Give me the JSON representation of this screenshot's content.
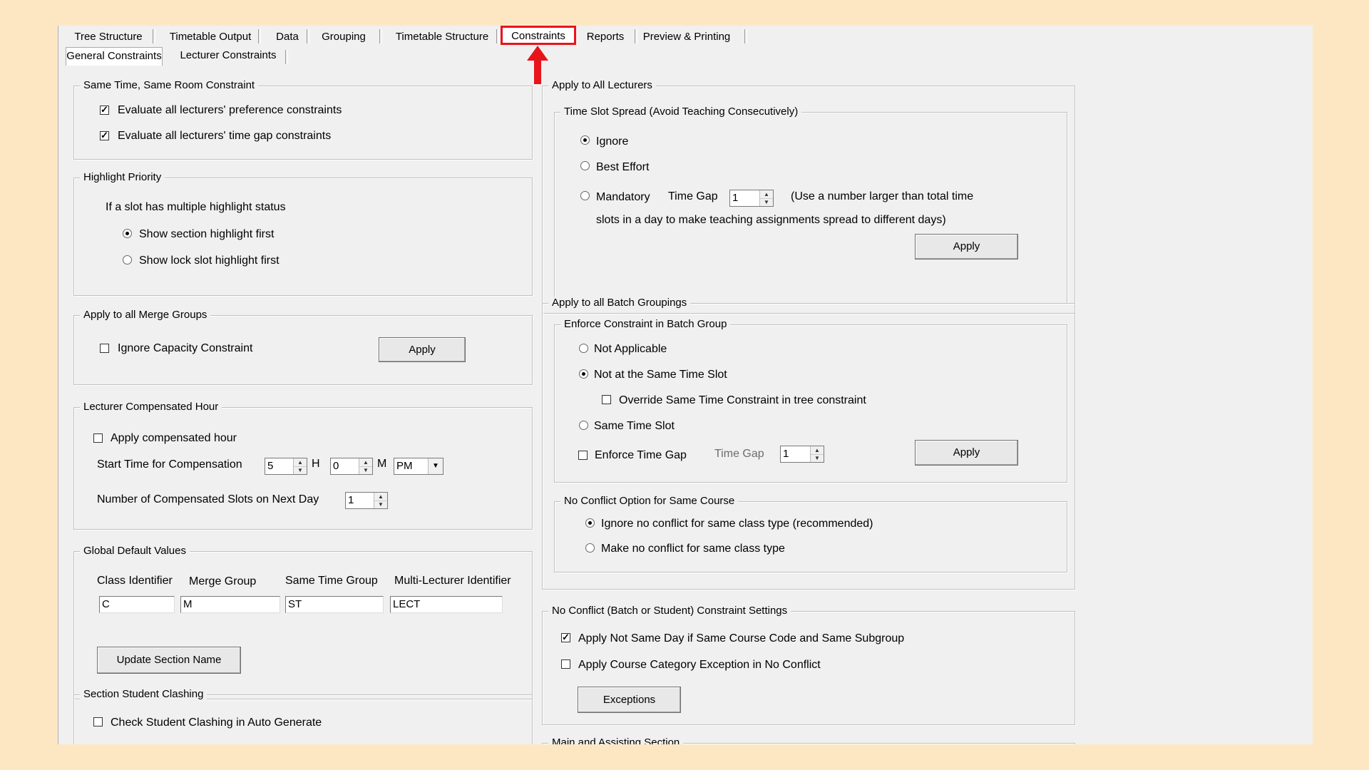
{
  "tabs": [
    "Tree Structure",
    "Timetable Output",
    "Data",
    "Grouping",
    "Timetable Structure",
    "Constraints",
    "Reports",
    "Preview & Printing"
  ],
  "sub_tabs": [
    "General Constraints",
    "Lecturer Constraints"
  ],
  "highlight_color": "#e8141c",
  "same_time_room": {
    "title": "Same Time, Same Room Constraint",
    "eval_pref": "Evaluate all lecturers' preference constraints",
    "eval_gap": "Evaluate all lecturers' time gap constraints"
  },
  "highlight_priority": {
    "title": "Highlight Priority",
    "desc": "If a slot has multiple highlight status",
    "opt_section": "Show section highlight first",
    "opt_lock": "Show lock slot highlight first"
  },
  "merge_groups": {
    "title": "Apply to all Merge Groups",
    "ignore_capacity": "Ignore Capacity Constraint",
    "apply": "Apply"
  },
  "compensated": {
    "title": "Lecturer Compensated Hour",
    "apply_hour": "Apply compensated hour",
    "start_label": "Start Time for Compensation",
    "hour_value": "5",
    "h": "H",
    "minute_value": "0",
    "m": "M",
    "ampm": "PM",
    "slots_label": "Number of Compensated Slots on Next Day",
    "slots_value": "1"
  },
  "global_defaults": {
    "title": "Global Default Values",
    "class_label": "Class Identifier",
    "merge_label": "Merge Group",
    "same_label": "Same Time Group",
    "multi_label": "Multi-Lecturer Identifier",
    "class_value": "C",
    "merge_value": "M",
    "same_value": "ST",
    "multi_value": "LECT",
    "update_btn": "Update Section Name"
  },
  "section_clash": {
    "title": "Section Student Clashing",
    "check": "Check Student Clashing in Auto Generate"
  },
  "all_lecturers": {
    "title": "Apply to All Lecturers",
    "spread_title": "Time Slot Spread (Avoid Teaching Consecutively)",
    "ignore": "Ignore",
    "best": "Best Effort",
    "mandatory": "Mandatory",
    "time_gap_label": "Time Gap",
    "time_gap_value": "1",
    "note1": "(Use a number larger than total time",
    "note2": "slots in a day to make teaching assignments spread to different days)",
    "apply": "Apply"
  },
  "batch": {
    "title": "Apply to all Batch Groupings",
    "enforce_title": "Enforce Constraint in Batch Group",
    "not_applicable": "Not Applicable",
    "not_same": "Not at the Same Time Slot",
    "override": "Override Same Time Constraint in tree constraint",
    "same_slot": "Same Time Slot",
    "enforce_gap": "Enforce Time Gap",
    "time_gap_label": "Time Gap",
    "time_gap_value": "1",
    "apply": "Apply",
    "no_conflict_title": "No Conflict Option for Same Course",
    "ignore_nc": "Ignore no conflict for same class type (recommended)",
    "make_nc": "Make no conflict for same class type"
  },
  "no_conflict": {
    "title": "No Conflict (Batch or Student) Constraint Settings",
    "same_day": "Apply Not Same Day if Same Course Code and Same Subgroup",
    "category": "Apply Course Category Exception in No Conflict",
    "exceptions": "Exceptions"
  },
  "main_assisting": {
    "title": "Main and Assisting Section"
  }
}
